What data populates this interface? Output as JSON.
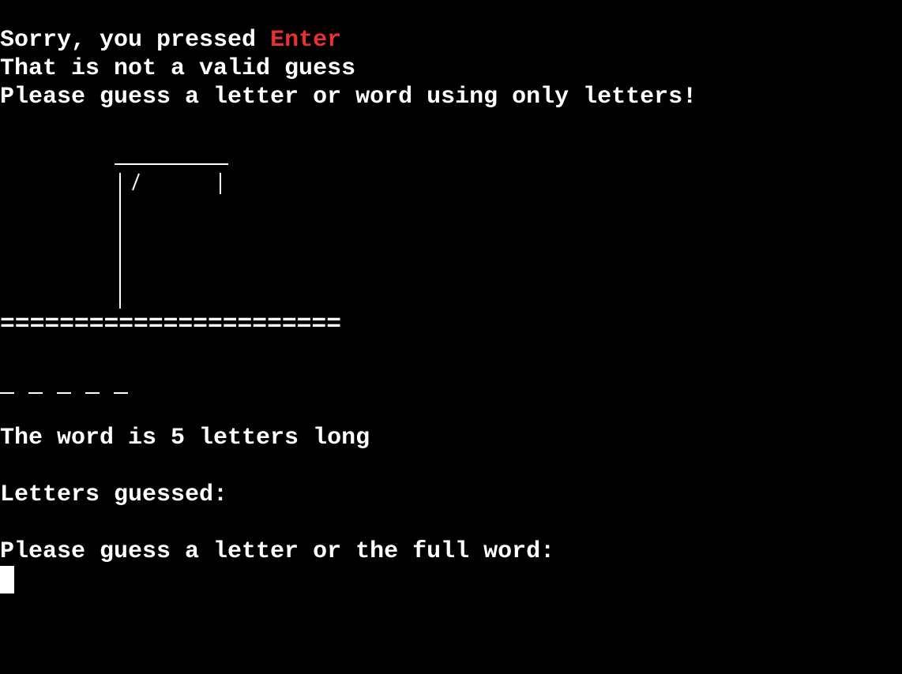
{
  "messages": {
    "sorry_prefix": "Sorry, you pressed ",
    "pressed_key": "Enter",
    "invalid_guess": "That is not a valid guess",
    "hint": "Please guess a letter or word using only letters!"
  },
  "board": {
    "ground": "======================="
  },
  "word": {
    "blank_count": 5,
    "length_text": "The word is 5 letters long"
  },
  "letters_guessed": {
    "label": "Letters guessed:",
    "value": ""
  },
  "prompt": {
    "text": "Please guess a letter or the full word:"
  },
  "colors": {
    "background": "#000000",
    "text": "#ffffff",
    "key_highlight": "#e8322e"
  }
}
